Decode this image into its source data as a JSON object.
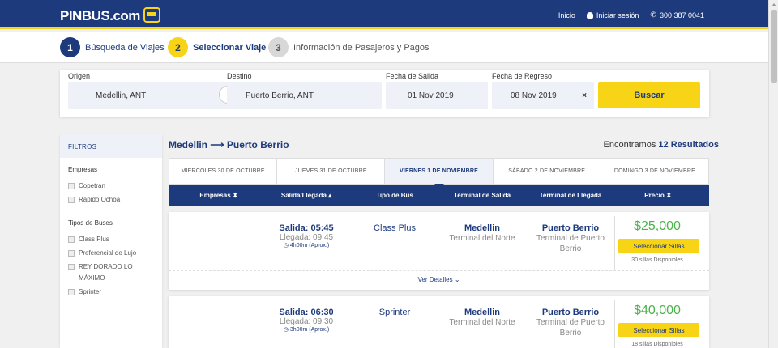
{
  "header": {
    "logo": "PINBUS.com",
    "nav": {
      "home": "Inicio",
      "login": "Iniciar sesión",
      "phone": "300 387 0041"
    }
  },
  "steps": [
    {
      "num": "1",
      "label": "Búsqueda de Viajes"
    },
    {
      "num": "2",
      "label": "Seleccionar Viaje"
    },
    {
      "num": "3",
      "label": "Información de Pasajeros y Pagos"
    }
  ],
  "search": {
    "origin_label": "Origen",
    "origin": "Medellin, ANT",
    "dest_label": "Destino",
    "dest": "Puerto Berrio, ANT",
    "depart_label": "Fecha de Salida",
    "depart": "01 Nov 2019",
    "return_label": "Fecha de Regreso",
    "return": "08 Nov 2019",
    "clear": "×",
    "button": "Buscar"
  },
  "filters": {
    "title": "FILTROS",
    "companies_label": "Empresas",
    "companies": [
      "Copetran",
      "Rápido Ochoa"
    ],
    "bus_types_label": "Tipos de Buses",
    "bus_types": [
      "Class Plus",
      "Preferencial de Lujo",
      "REY DORADO LO MÁXIMO",
      "Sprinter"
    ]
  },
  "results": {
    "route": "Medellin ⟶ Puerto Berrio",
    "found_prefix": "Encontramos",
    "found_count": "12 Resultados"
  },
  "date_tabs": [
    "MIÉRCOLES 30 DE OCTUBRE",
    "JUEVES 31 DE OCTUBRE",
    "VIERNES 1 DE NOVIEMBRE",
    "SÁBADO 2 DE NOVIEMBRE",
    "DOMINGO 3 DE NOVIEMBRE"
  ],
  "active_tab": 2,
  "columns": {
    "empresas": "Empresas ⬍",
    "salida": "Salida/Llegada ▴",
    "tipo": "Tipo de Bus",
    "terminal_salida": "Terminal de Salida",
    "terminal_llegada": "Terminal de Llegada",
    "precio": "Precio ⬍"
  },
  "trips": [
    {
      "salida": "Salida: 05:45",
      "llegada": "Llegada: 09:45",
      "duracion": "◷ 4h00m (Aprox.)",
      "bus": "Class Plus",
      "from_city": "Medellin",
      "from_term": "Terminal del Norte",
      "to_city": "Puerto Berrio",
      "to_term": "Terminal de Puerto Berrio",
      "price": "$25,000",
      "button": "Seleccionar Sillas",
      "seats": "30 sillas Disponibles",
      "more": "Ver Detalles ⌄"
    },
    {
      "salida": "Salida: 06:30",
      "llegada": "Llegada: 09:30",
      "duracion": "◷ 3h00m (Aprox.)",
      "bus": "Sprinter",
      "from_city": "Medellin",
      "from_term": "Terminal del Norte",
      "to_city": "Puerto Berrio",
      "to_term": "Terminal de Puerto Berrio",
      "price": "$40,000",
      "button": "Seleccionar Sillas",
      "seats": "18 sillas Disponibles"
    }
  ],
  "colors": {
    "primary": "#1d3a7c",
    "accent": "#f7d416",
    "price": "#4bb34b"
  }
}
